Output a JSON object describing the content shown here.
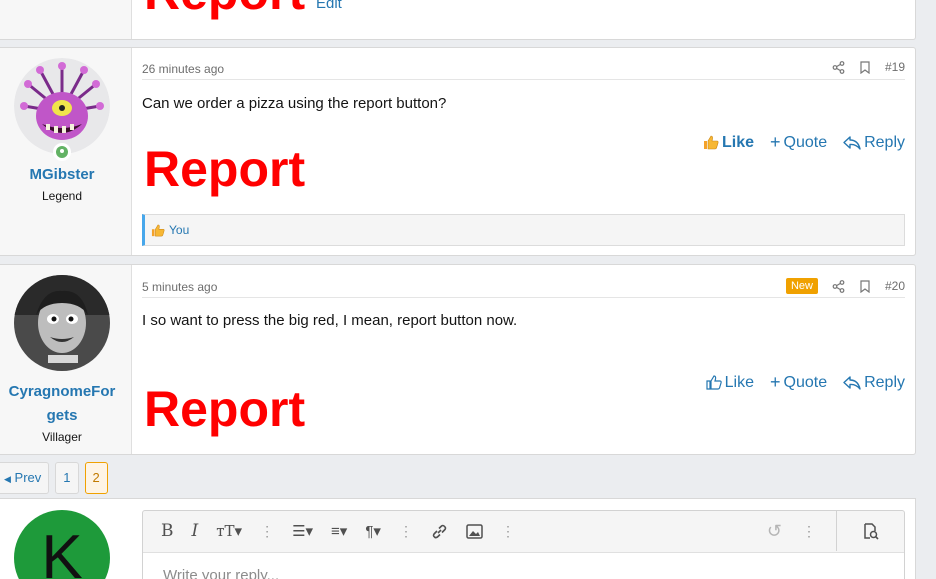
{
  "top_post": {
    "report_label": "Report",
    "edit_label": "Edit"
  },
  "posts": [
    {
      "username": "MGibster",
      "user_title": "Legend",
      "time": "26 minutes ago",
      "number": "#19",
      "body": "Can we order a pizza using the report button?",
      "report_label": "Report",
      "like_label": "Like",
      "quote_label": "Quote",
      "reply_label": "Reply",
      "reaction_text": "You"
    },
    {
      "username_line1": "CyragnomeFor",
      "username_line2": "gets",
      "user_title": "Villager",
      "time": "5 minutes ago",
      "badge": "New",
      "number": "#20",
      "body": "I so want to press the big red, I mean, report button now.",
      "report_label": "Report",
      "like_label": "Like",
      "quote_label": "Quote",
      "reply_label": "Reply"
    }
  ],
  "pagination": {
    "prev_label": "Prev",
    "pages": [
      "1",
      "2"
    ],
    "current": "2"
  },
  "editor": {
    "avatar_letter": "K",
    "placeholder": "Write your reply..."
  },
  "colors": {
    "accent": "#2577b1",
    "report": "#ff0000",
    "new_badge": "#f0a100",
    "online": "#63b265"
  }
}
